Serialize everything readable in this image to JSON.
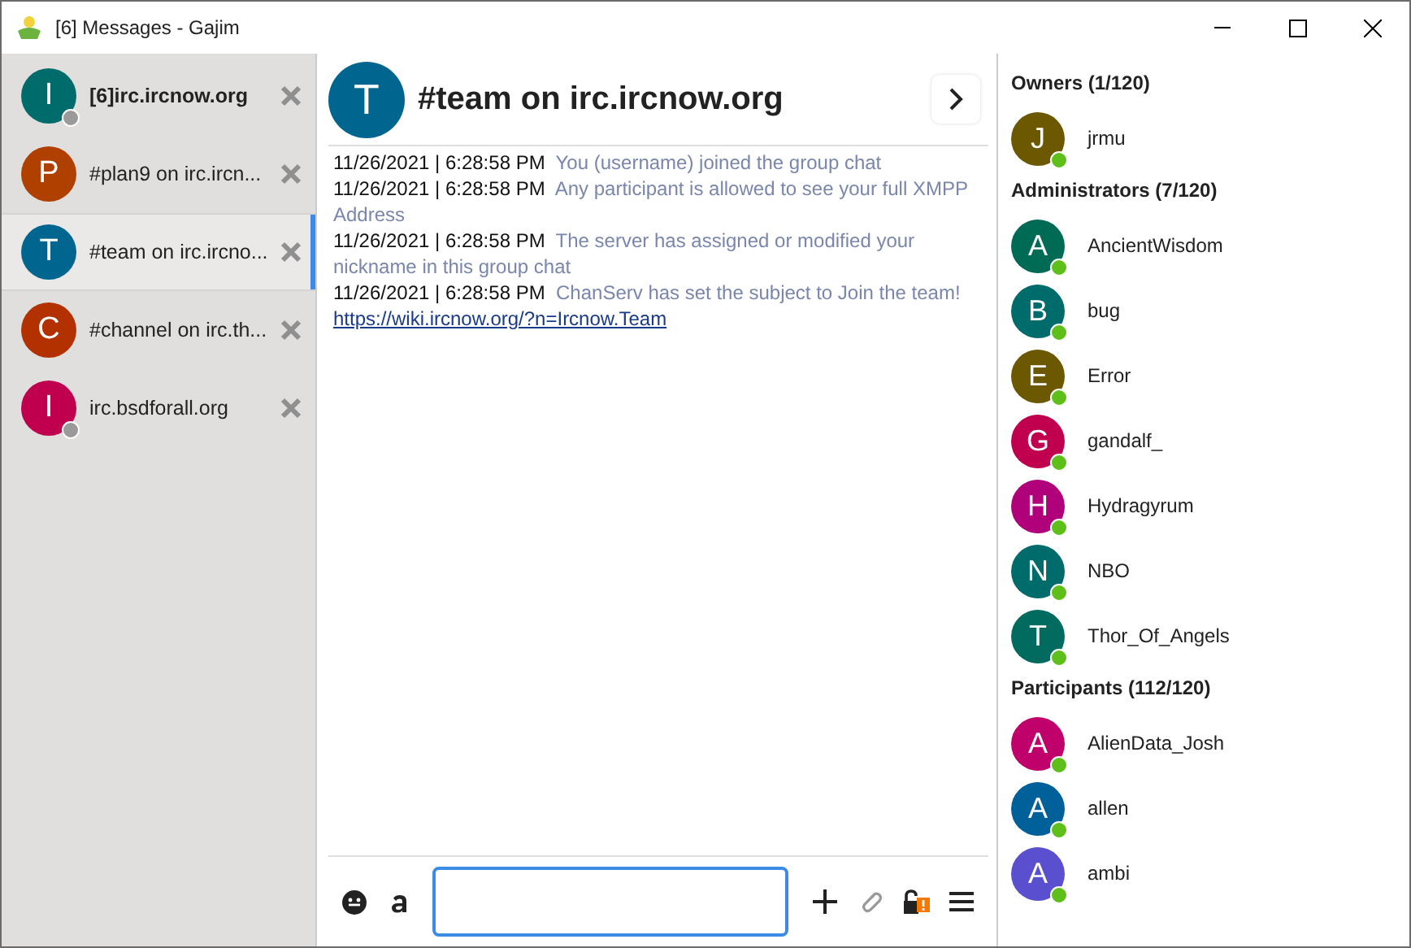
{
  "window": {
    "title": "[6] Messages - Gajim"
  },
  "chats": [
    {
      "initial": "I",
      "name": "[6]irc.ircnow.org",
      "color": "#006b6b",
      "unread": true,
      "status_dot": true,
      "selected": false
    },
    {
      "initial": "P",
      "name": "#plan9 on irc.ircn...",
      "color": "#b04000",
      "unread": false,
      "selected": false
    },
    {
      "initial": "T",
      "name": "#team on irc.ircno...",
      "color": "#00658f",
      "unread": false,
      "selected": true
    },
    {
      "initial": "C",
      "name": "#channel on irc.th...",
      "color": "#b33000",
      "unread": false,
      "selected": false
    },
    {
      "initial": "I",
      "name": "irc.bsdforall.org",
      "color": "#c0004f",
      "unread": false,
      "status_dot": true,
      "selected": false
    }
  ],
  "header": {
    "initial": "T",
    "title": "#team on irc.ircnow.org",
    "color": "#00658f"
  },
  "messages": [
    {
      "time": "11/26/2021 | 6:28:58 PM",
      "text": "You (username) joined the group chat"
    },
    {
      "time": "11/26/2021 | 6:28:58 PM",
      "text": "Any participant is allowed to see your full XMPP Address"
    },
    {
      "time": "11/26/2021 | 6:28:58 PM",
      "text": "The server has assigned or modified your nickname in this group chat"
    },
    {
      "time": "11/26/2021 | 6:28:58 PM",
      "text": "ChanServ has set the subject to Join the team!",
      "link": "https://wiki.ircnow.org/?n=Ircnow.Team"
    }
  ],
  "roster": [
    {
      "title": "Owners (1/120)",
      "members": [
        {
          "initial": "J",
          "name": "jrmu",
          "color": "#6b5800",
          "online": true
        }
      ]
    },
    {
      "title": "Administrators (7/120)",
      "members": [
        {
          "initial": "A",
          "name": "AncientWisdom",
          "color": "#006b55",
          "online": true
        },
        {
          "initial": "B",
          "name": "bug",
          "color": "#006b6b",
          "online": true
        },
        {
          "initial": "E",
          "name": "Error",
          "color": "#6b5800",
          "online": true
        },
        {
          "initial": "G",
          "name": "gandalf_",
          "color": "#c0004f",
          "online": true
        },
        {
          "initial": "H",
          "name": "Hydragyrum",
          "color": "#b0007a",
          "online": true
        },
        {
          "initial": "N",
          "name": "NBO",
          "color": "#006b6b",
          "online": true
        },
        {
          "initial": "T",
          "name": "Thor_Of_Angels",
          "color": "#006b5e",
          "online": true
        }
      ]
    },
    {
      "title": "Participants (112/120)",
      "members": [
        {
          "initial": "A",
          "name": "AlienData_Josh",
          "color": "#c0006b",
          "online": true
        },
        {
          "initial": "A",
          "name": "allen",
          "color": "#00609a",
          "online": true
        },
        {
          "initial": "A",
          "name": "ambi",
          "color": "#5a4fcf",
          "online": true
        }
      ]
    }
  ]
}
